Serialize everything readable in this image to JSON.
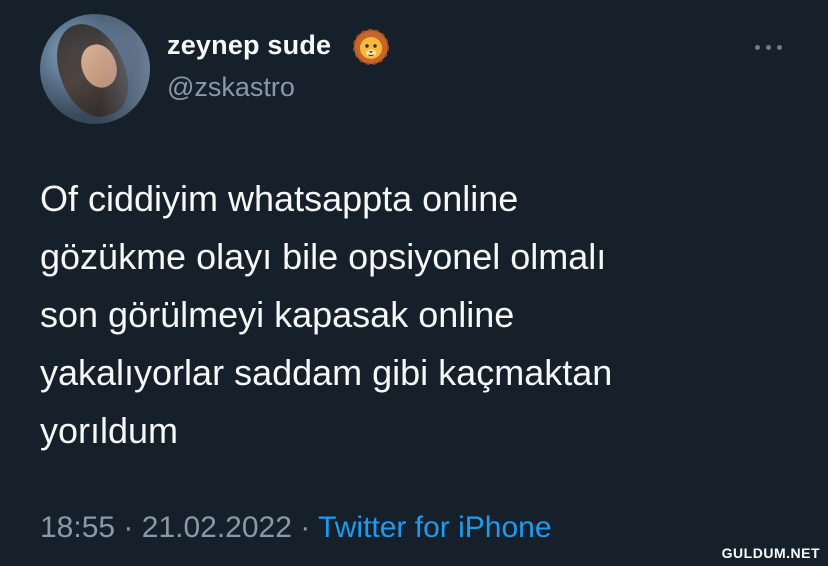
{
  "tweet": {
    "display_name": "zeynep sude",
    "handle": "@zskastro",
    "name_emoji_icon": "lion-face-icon",
    "text": "Of ciddiyim whatsappta online\ngözükme olayı bile opsiyonel olmalı\nson görülmeyi kapasak online\nyakalıyorlar saddam gibi kaçmaktan\nyorıldum",
    "time": "18:55",
    "separator": "·",
    "date": "21.02.2022",
    "source": "Twitter for iPhone"
  },
  "watermark": "GULDUM.NET",
  "colors": {
    "background": "#15202b",
    "text": "#f7f9f9",
    "secondary": "#8b98a5",
    "accent": "#1d9bf0"
  }
}
